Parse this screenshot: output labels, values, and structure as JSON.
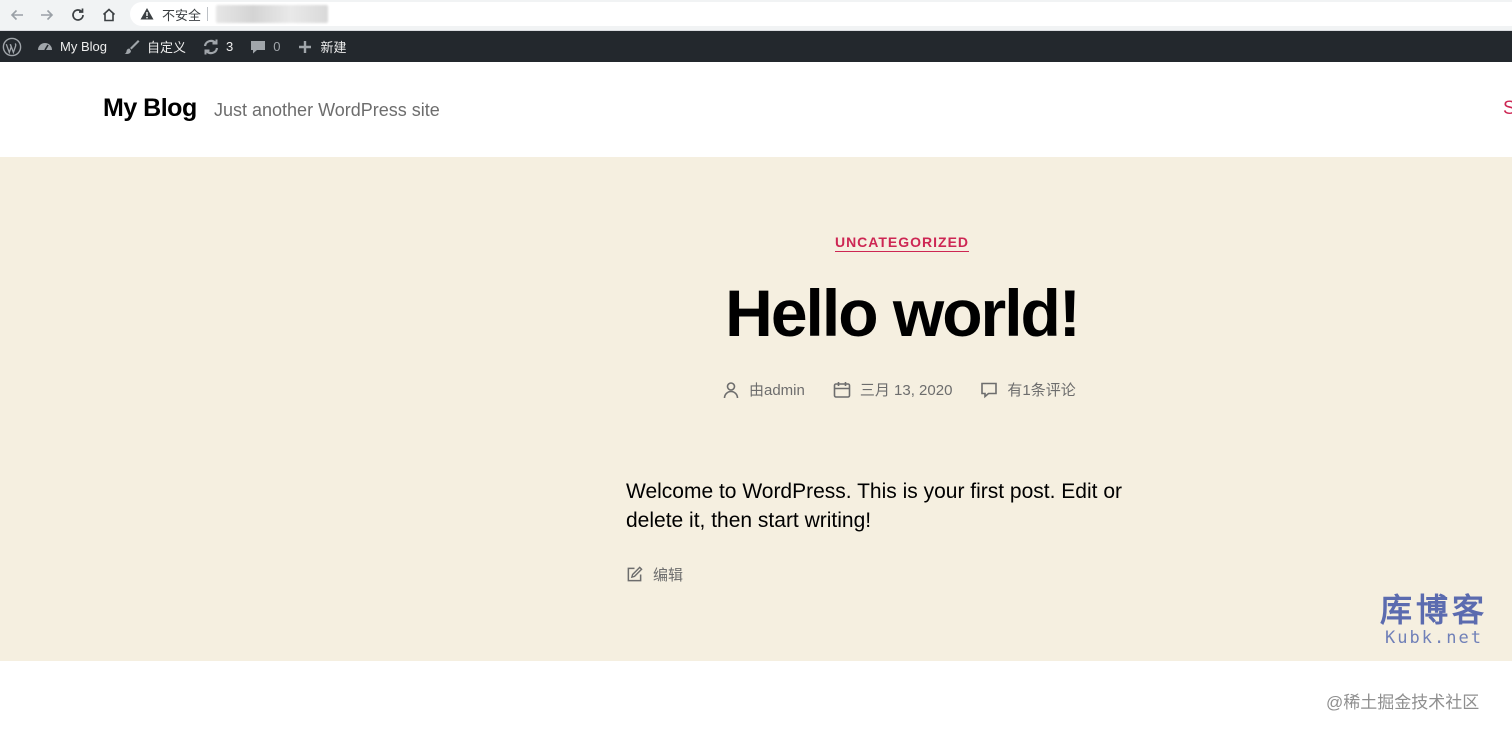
{
  "browser": {
    "security_label": "不安全"
  },
  "admin_bar": {
    "site_name": "My Blog",
    "customize": "自定义",
    "updates_count": "3",
    "comments_count": "0",
    "new_label": "新建"
  },
  "site": {
    "title": "My Blog",
    "description": "Just another WordPress site",
    "menu_partial": "S"
  },
  "post": {
    "category": "UNCATEGORIZED",
    "title": "Hello world!",
    "author": "由admin",
    "date": "三月 13, 2020",
    "comments": "有1条评论",
    "content": "Welcome to WordPress. This is your first post. Edit or delete it, then start writing!",
    "edit_label": "编辑"
  },
  "watermarks": {
    "kubk_cn": "库博客",
    "kubk_en": "Kubk.net",
    "juejin": "@稀土掘金技术社区"
  },
  "colors": {
    "accent": "#cd2653",
    "admin_bar_bg": "#23282d",
    "post_bg": "#f5efe0"
  }
}
